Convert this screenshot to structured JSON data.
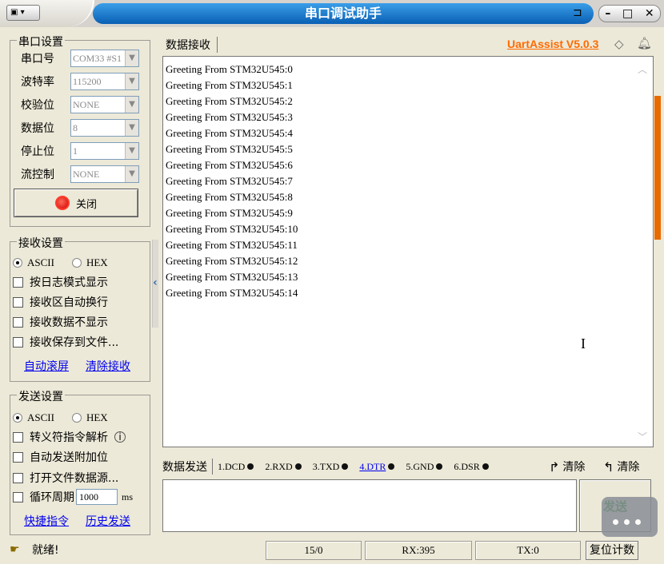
{
  "window": {
    "title": "串口调试助手",
    "brand": "UartAssist V5.0.3"
  },
  "serial_settings": {
    "title": "串口设置",
    "fields": [
      {
        "label": "串口号",
        "value": "COM33 #S1"
      },
      {
        "label": "波特率",
        "value": "115200"
      },
      {
        "label": "校验位",
        "value": "NONE"
      },
      {
        "label": "数据位",
        "value": "8"
      },
      {
        "label": "停止位",
        "value": "1"
      },
      {
        "label": "流控制",
        "value": "NONE"
      }
    ],
    "close_button": "关闭"
  },
  "receive_settings": {
    "title": "接收设置",
    "mode_ascii": "ASCII",
    "mode_hex": "HEX",
    "selected_mode": "ASCII",
    "options": [
      "按日志模式显示",
      "接收区自动换行",
      "接收数据不显示",
      "接收保存到文件..."
    ],
    "link_autoscroll": "自动滚屏",
    "link_clear": "清除接收"
  },
  "send_settings": {
    "title": "发送设置",
    "mode_ascii": "ASCII",
    "mode_hex": "HEX",
    "selected_mode": "ASCII",
    "options": [
      "转义符指令解析",
      "自动发送附加位",
      "打开文件数据源...",
      "循环周期"
    ],
    "cycle_value": "1000",
    "cycle_unit": "ms",
    "link_shortcut": "快捷指令",
    "link_history": "历史发送"
  },
  "receive_area": {
    "tab": "数据接收",
    "lines": [
      "Greeting From STM32U545:0",
      "Greeting From STM32U545:1",
      "Greeting From STM32U545:2",
      "Greeting From STM32U545:3",
      "Greeting From STM32U545:4",
      "Greeting From STM32U545:5",
      "Greeting From STM32U545:6",
      "Greeting From STM32U545:7",
      "Greeting From STM32U545:8",
      "Greeting From STM32U545:9",
      "Greeting From STM32U545:10",
      "Greeting From STM32U545:11",
      "Greeting From STM32U545:12",
      "Greeting From STM32U545:13",
      "Greeting From STM32U545:14"
    ]
  },
  "send_area": {
    "tab": "数据发送",
    "pins": [
      "1.DCD",
      "2.RXD",
      "3.TXD",
      "4.DTR",
      "5.GND",
      "6.DSR"
    ],
    "clear1": "清除",
    "clear2": "清除",
    "send_button": "发送"
  },
  "status": {
    "text": "就绪!",
    "count": "15/0",
    "rx": "RX:395",
    "tx": "TX:0",
    "reset": "复位计数"
  }
}
